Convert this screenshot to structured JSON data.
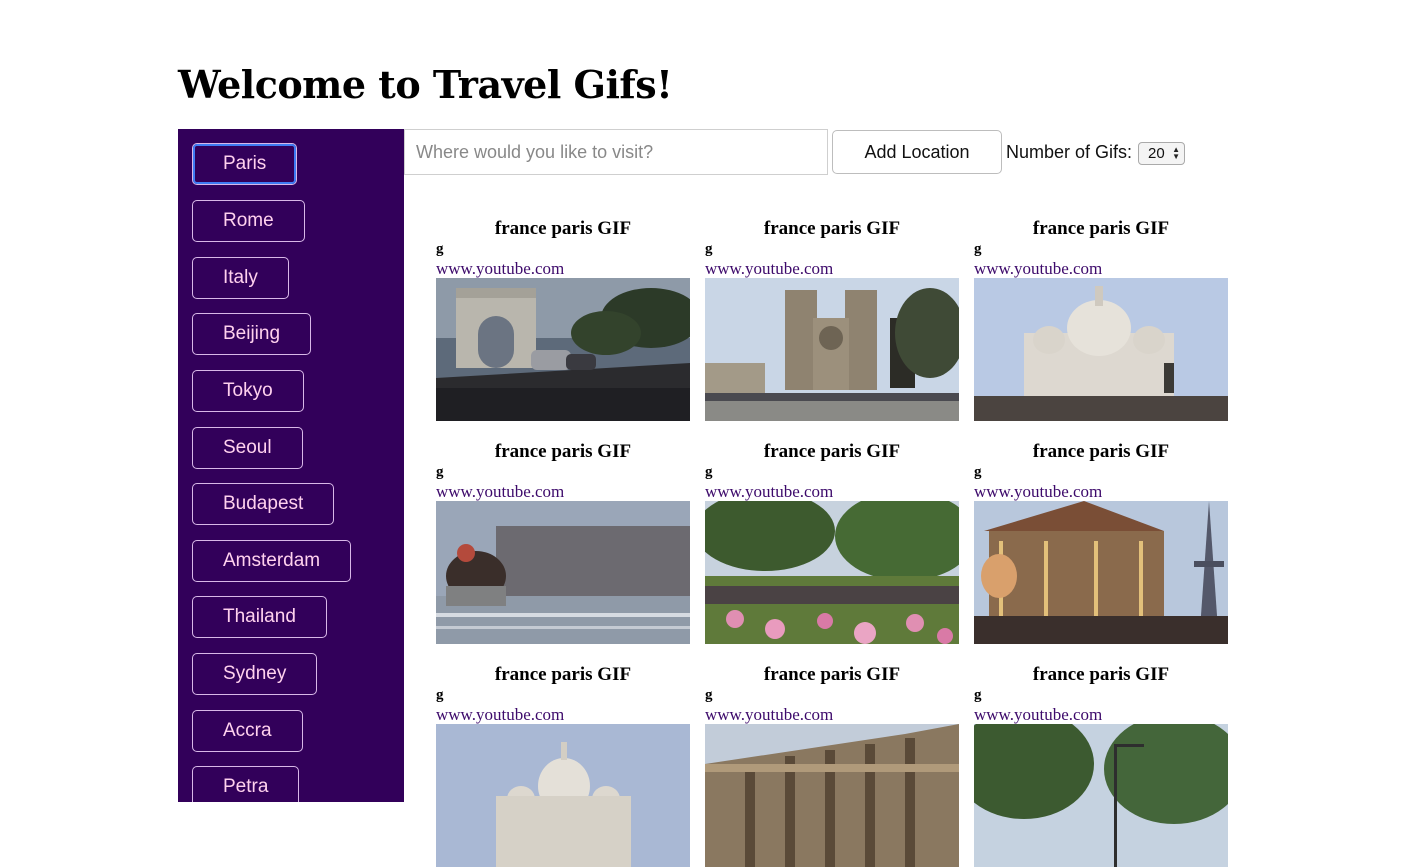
{
  "header": {
    "title": "Welcome to Travel Gifs!"
  },
  "sidebar": {
    "locations": [
      {
        "label": "Paris",
        "active": true
      },
      {
        "label": "Rome"
      },
      {
        "label": "Italy"
      },
      {
        "label": "Beijing"
      },
      {
        "label": "Tokyo"
      },
      {
        "label": "Seoul"
      },
      {
        "label": "Budapest"
      },
      {
        "label": "Amsterdam"
      },
      {
        "label": "Thailand"
      },
      {
        "label": "Sydney"
      },
      {
        "label": "Accra"
      },
      {
        "label": "Petra"
      }
    ]
  },
  "toolbar": {
    "search_placeholder": "Where would you like to visit?",
    "search_value": "",
    "add_label": "Add Location",
    "count_label": "Number of Gifs:",
    "count_value": "20"
  },
  "gifs": [
    {
      "title": "france paris GIF",
      "rating": "g",
      "source": "www.youtube.com",
      "scene": "arc-de-triomphe"
    },
    {
      "title": "france paris GIF",
      "rating": "g",
      "source": "www.youtube.com",
      "scene": "notre-dame"
    },
    {
      "title": "france paris GIF",
      "rating": "g",
      "source": "www.youtube.com",
      "scene": "sacre-coeur"
    },
    {
      "title": "france paris GIF",
      "rating": "g",
      "source": "www.youtube.com",
      "scene": "river-seine"
    },
    {
      "title": "france paris GIF",
      "rating": "g",
      "source": "www.youtube.com",
      "scene": "park-flowers"
    },
    {
      "title": "france paris GIF",
      "rating": "g",
      "source": "www.youtube.com",
      "scene": "carousel-eiffel"
    },
    {
      "title": "france paris GIF",
      "rating": "g",
      "source": "www.youtube.com",
      "scene": "sacre-coeur-dome"
    },
    {
      "title": "france paris GIF",
      "rating": "g",
      "source": "www.youtube.com",
      "scene": "opera-house"
    },
    {
      "title": "france paris GIF",
      "rating": "g",
      "source": "www.youtube.com",
      "scene": "tree-avenue"
    }
  ],
  "colors": {
    "sidebar_bg": "#32005a",
    "button_text": "#ffd1ee",
    "button_border": "#d8b8e8",
    "link": "#3d0a6b"
  }
}
